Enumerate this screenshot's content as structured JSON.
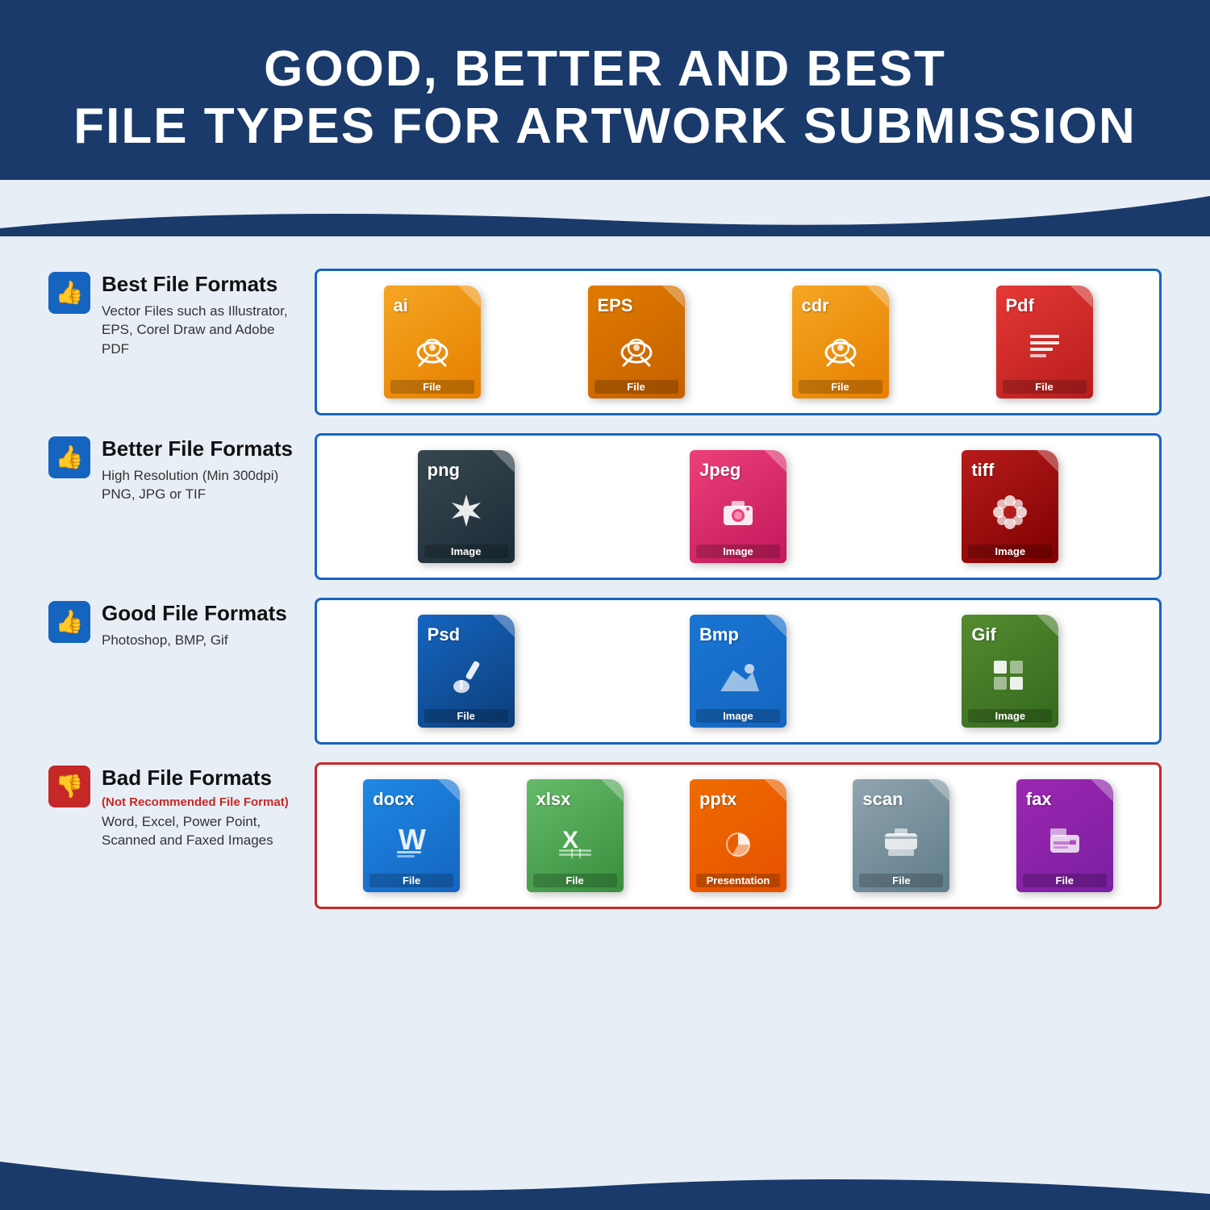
{
  "header": {
    "line1": "GOOD, BETTER AND BEST",
    "line2": "FILE TYPES FOR ARTWORK SUBMISSION"
  },
  "rows": [
    {
      "id": "best",
      "thumb": "up",
      "title": "Best File Formats",
      "subtitle": null,
      "description": "Vector Files such as Illustrator,\nEPS, Corel Draw and Adobe PDF",
      "borderColor": "blue",
      "files": [
        {
          "ext": "ai",
          "label": "File",
          "color": "orange",
          "icon": "✒️"
        },
        {
          "ext": "EPS",
          "label": "File",
          "color": "dark-orange",
          "icon": "✒️"
        },
        {
          "ext": "cdr",
          "label": "File",
          "color": "orange",
          "icon": "✒️"
        },
        {
          "ext": "Pdf",
          "label": "File",
          "color": "red-file",
          "icon": "📄"
        }
      ]
    },
    {
      "id": "better",
      "thumb": "up",
      "title": "Better File Formats",
      "subtitle": null,
      "description": "High Resolution (Min 300dpi)\nPNG, JPG or TIF",
      "borderColor": "blue",
      "files": [
        {
          "ext": "png",
          "label": "Image",
          "color": "dark-gray",
          "icon": "✦"
        },
        {
          "ext": "Jpeg",
          "label": "Image",
          "color": "pink",
          "icon": "📷"
        },
        {
          "ext": "tiff",
          "label": "Image",
          "color": "dark-red",
          "icon": "✿"
        }
      ]
    },
    {
      "id": "good",
      "thumb": "up",
      "title": "Good File Formats",
      "subtitle": null,
      "description": "Photoshop, BMP, Gif",
      "borderColor": "blue",
      "files": [
        {
          "ext": "Psd",
          "label": "File",
          "color": "dark-blue",
          "icon": "🖌️"
        },
        {
          "ext": "Bmp",
          "label": "Image",
          "color": "medium-blue",
          "icon": "🏔️"
        },
        {
          "ext": "Gif",
          "label": "Image",
          "color": "green-file",
          "icon": "⊞"
        }
      ]
    },
    {
      "id": "bad",
      "thumb": "down",
      "title": "Bad File Formats",
      "subtitle": "(Not Recommended File Format)",
      "description": "Word, Excel, Power Point,\nScanned and Faxed Images",
      "borderColor": "red",
      "files": [
        {
          "ext": "docx",
          "label": "File",
          "color": "blue-doc",
          "icon": "W"
        },
        {
          "ext": "xlsx",
          "label": "File",
          "color": "green-xl",
          "icon": "X"
        },
        {
          "ext": "pptx",
          "label": "Presentation",
          "color": "orange-ppt",
          "icon": "📊"
        },
        {
          "ext": "scan",
          "label": "File",
          "color": "gray-scan",
          "icon": "🖨️"
        },
        {
          "ext": "fax",
          "label": "File",
          "color": "purple-fax",
          "icon": "📠"
        }
      ]
    }
  ],
  "icons": {
    "thumbs_up": "👍",
    "thumbs_down": "👎"
  }
}
